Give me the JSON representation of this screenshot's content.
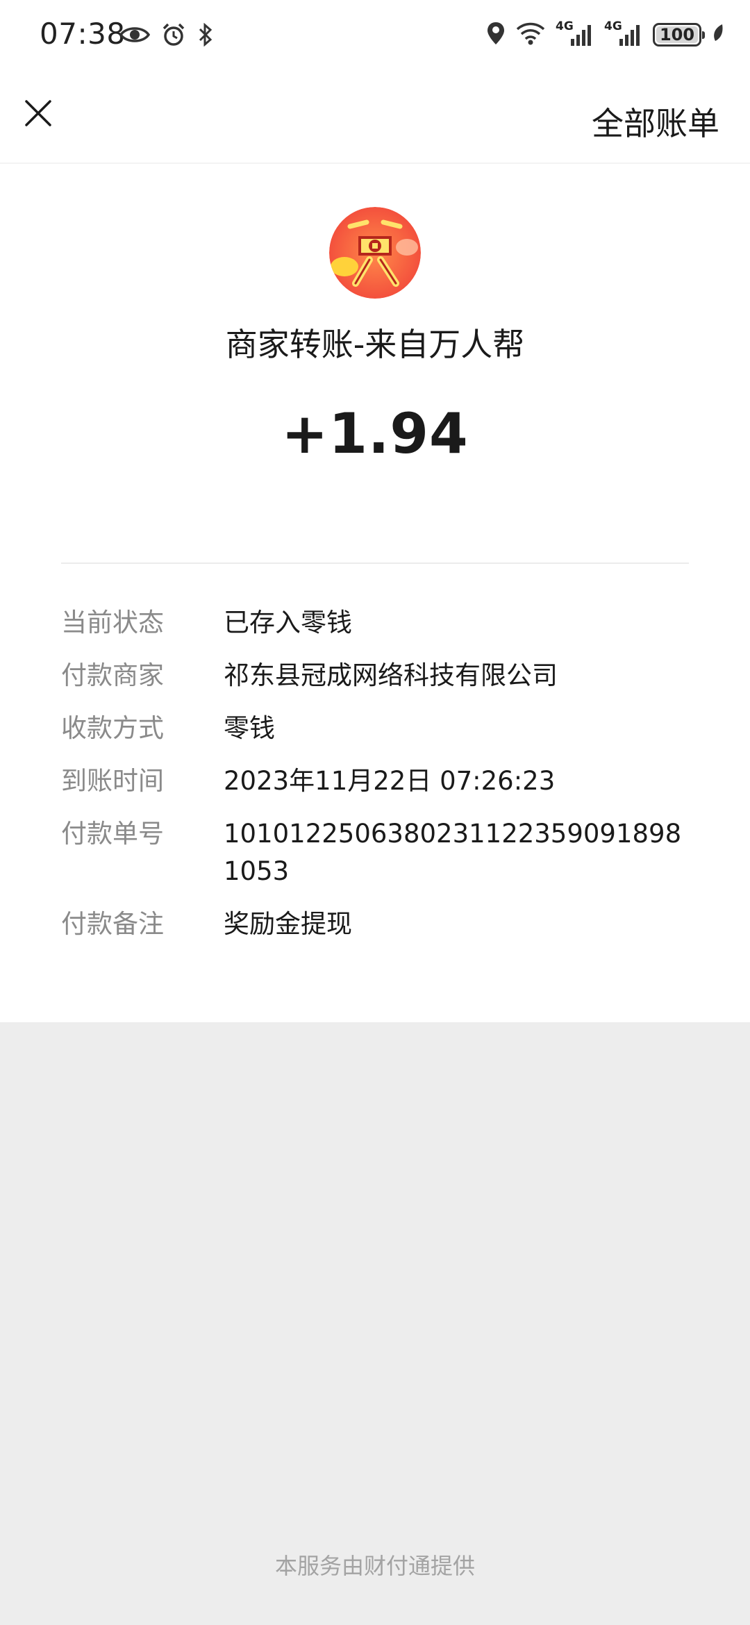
{
  "status_bar": {
    "time": "07:38",
    "network_1": "4G",
    "network_2": "4G",
    "battery": "100",
    "icons": [
      "eye-icon",
      "alarm-icon",
      "bluetooth-icon",
      "location-icon",
      "wifi-icon",
      "signal-icon",
      "signal-icon",
      "battery-icon",
      "leaf-icon"
    ]
  },
  "nav": {
    "close_icon": "close-icon",
    "all_bills": "全部账单"
  },
  "transaction": {
    "avatar_icon": "reward-badge-icon",
    "title": "商家转账-来自万人帮",
    "amount": "+1.94"
  },
  "details": [
    {
      "label": "当前状态",
      "value": "已存入零钱"
    },
    {
      "label": "付款商家",
      "value": "祁东县冠成网络科技有限公司"
    },
    {
      "label": "收款方式",
      "value": "零钱"
    },
    {
      "label": "到账时间",
      "value": "2023年11月22日 07:26:23"
    },
    {
      "label": "付款单号",
      "value": "10101225063802311223590918981053"
    },
    {
      "label": "付款备注",
      "value": "奖励金提现"
    }
  ],
  "footer": "本服务由财付通提供",
  "colors": {
    "page_bg": "#ededed",
    "card_bg": "#ffffff",
    "label": "#8a8a8a",
    "text": "#1a1a1a",
    "footer": "#a3a3a3"
  }
}
